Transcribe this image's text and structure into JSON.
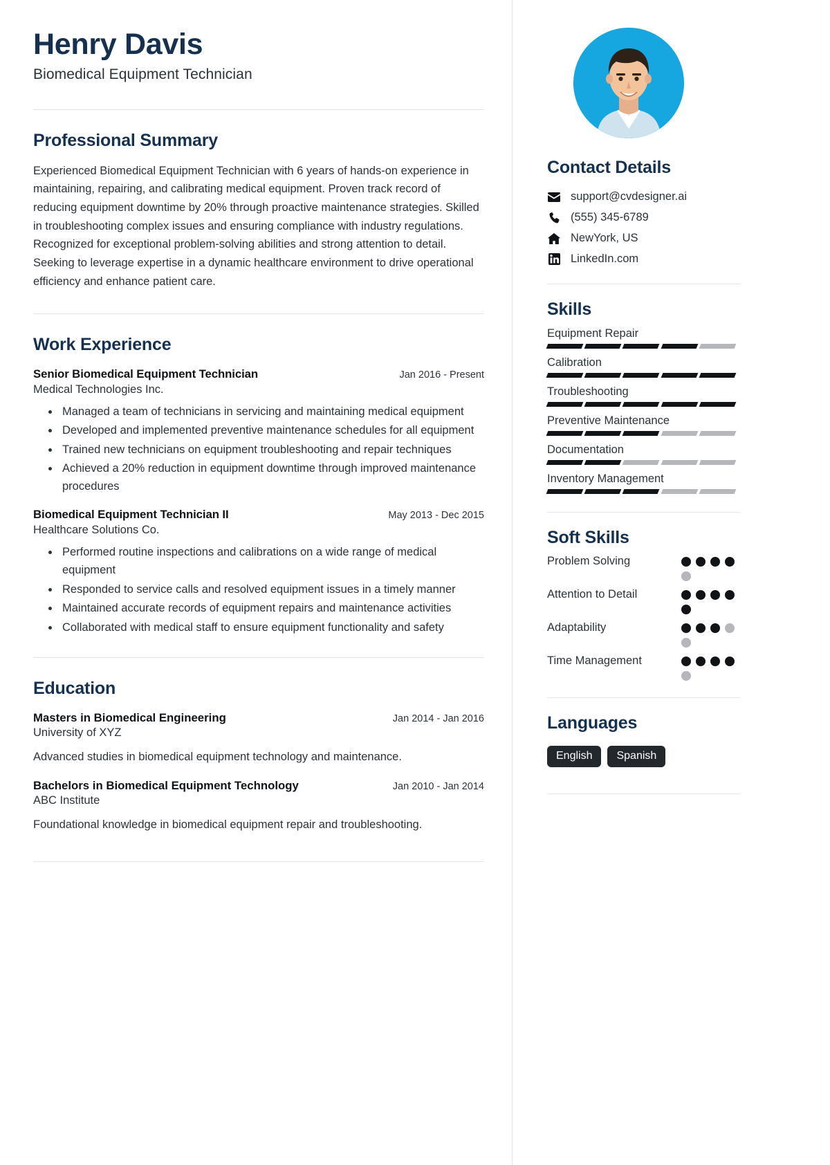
{
  "header": {
    "name": "Henry Davis",
    "job_title": "Biomedical Equipment Technician"
  },
  "summary": {
    "heading": "Professional Summary",
    "text": "Experienced Biomedical Equipment Technician with 6 years of hands-on experience in maintaining, repairing, and calibrating medical equipment. Proven track record of reducing equipment downtime by 20% through proactive maintenance strategies. Skilled in troubleshooting complex issues and ensuring compliance with industry regulations. Recognized for exceptional problem-solving abilities and strong attention to detail. Seeking to leverage expertise in a dynamic healthcare environment to drive operational efficiency and enhance patient care."
  },
  "experience": {
    "heading": "Work Experience",
    "jobs": [
      {
        "role": "Senior Biomedical Equipment Technician",
        "date": "Jan 2016 - Present",
        "company": "Medical Technologies Inc.",
        "bullets": [
          "Managed a team of technicians in servicing and maintaining medical equipment",
          "Developed and implemented preventive maintenance schedules for all equipment",
          "Trained new technicians on equipment troubleshooting and repair techniques",
          "Achieved a 20% reduction in equipment downtime through improved maintenance procedures"
        ]
      },
      {
        "role": "Biomedical Equipment Technician II",
        "date": "May 2013 - Dec 2015",
        "company": "Healthcare Solutions Co.",
        "bullets": [
          "Performed routine inspections and calibrations on a wide range of medical equipment",
          "Responded to service calls and resolved equipment issues in a timely manner",
          "Maintained accurate records of equipment repairs and maintenance activities",
          "Collaborated with medical staff to ensure equipment functionality and safety"
        ]
      }
    ]
  },
  "education": {
    "heading": "Education",
    "entries": [
      {
        "degree": "Masters in Biomedical Engineering",
        "date": "Jan 2014 - Jan 2016",
        "school": "University of XYZ",
        "description": "Advanced studies in biomedical equipment technology and maintenance."
      },
      {
        "degree": "Bachelors in Biomedical Equipment Technology",
        "date": "Jan 2010 - Jan 2014",
        "school": "ABC Institute",
        "description": "Foundational knowledge in biomedical equipment repair and troubleshooting."
      }
    ]
  },
  "contact": {
    "heading": "Contact Details",
    "items": [
      {
        "icon": "envelope-icon",
        "value": "support@cvdesigner.ai"
      },
      {
        "icon": "phone-icon",
        "value": "(555) 345-6789"
      },
      {
        "icon": "home-icon",
        "value": "NewYork, US"
      },
      {
        "icon": "linkedin-icon",
        "value": "LinkedIn.com"
      }
    ]
  },
  "skills": {
    "heading": "Skills",
    "max_level": 5,
    "items": [
      {
        "name": "Equipment Repair",
        "level": 4
      },
      {
        "name": "Calibration",
        "level": 5
      },
      {
        "name": "Troubleshooting",
        "level": 5
      },
      {
        "name": "Preventive Maintenance",
        "level": 3
      },
      {
        "name": "Documentation",
        "level": 2
      },
      {
        "name": "Inventory Management",
        "level": 3
      }
    ]
  },
  "soft_skills": {
    "heading": "Soft Skills",
    "max_level": 5,
    "items": [
      {
        "name": "Problem Solving",
        "level": 4
      },
      {
        "name": "Attention to Detail",
        "level": 5
      },
      {
        "name": "Adaptability",
        "level": 3
      },
      {
        "name": "Time Management",
        "level": 4
      }
    ]
  },
  "languages": {
    "heading": "Languages",
    "items": [
      "English",
      "Spanish"
    ]
  },
  "colors": {
    "heading_blue": "#16314f",
    "body_text": "#2c3338",
    "bar_on": "#111417",
    "bar_off": "#b5b7ba",
    "chip_bg": "#22282c",
    "avatar_bg": "#16a7e0"
  }
}
